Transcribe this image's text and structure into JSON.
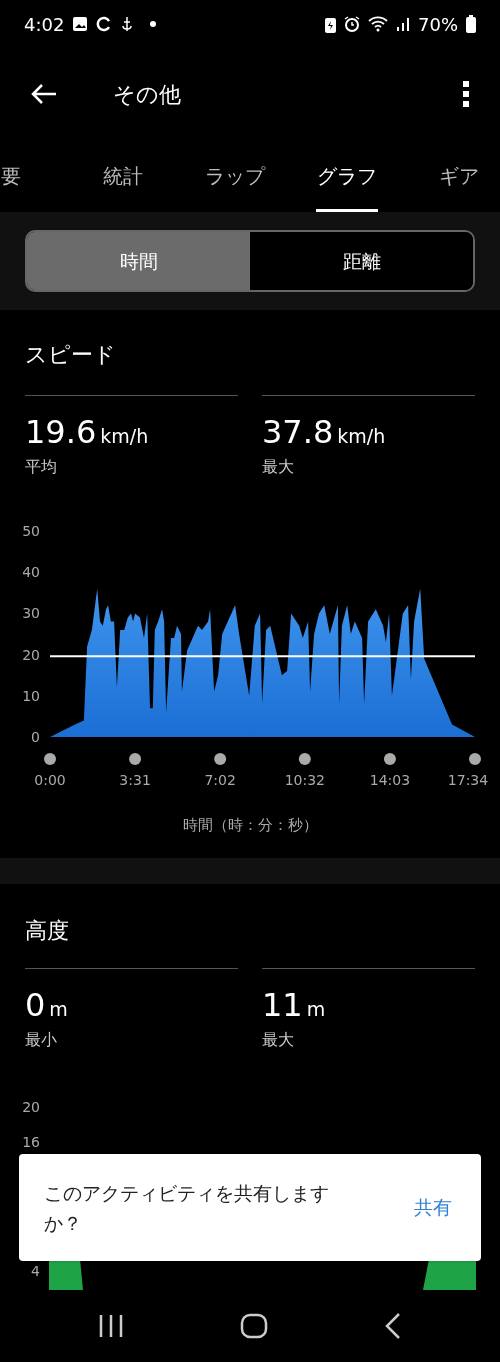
{
  "status_bar": {
    "time": "4:02",
    "battery": "70%"
  },
  "app_bar": {
    "title": "その他"
  },
  "tabs": [
    {
      "label": "要",
      "selected": false
    },
    {
      "label": "統計",
      "selected": false
    },
    {
      "label": "ラップ",
      "selected": false
    },
    {
      "label": "グラフ",
      "selected": true
    },
    {
      "label": "ギア",
      "selected": false
    }
  ],
  "segments": [
    {
      "label": "時間",
      "selected": true
    },
    {
      "label": "距離",
      "selected": false
    }
  ],
  "speed": {
    "title": "スピード",
    "stats": [
      {
        "value": "19.6",
        "unit": "km/h",
        "label": "平均"
      },
      {
        "value": "37.8",
        "unit": "km/h",
        "label": "最大"
      }
    ],
    "chart_data": {
      "type": "area",
      "xlabel": "時間（時：分：秒）",
      "xlim": [
        0,
        1054
      ],
      "ylim": [
        0,
        50
      ],
      "yticks": [
        0,
        10,
        20,
        30,
        40,
        50
      ],
      "xticks": [
        {
          "value": 0,
          "label": "0:00"
        },
        {
          "value": 211,
          "label": "3:31"
        },
        {
          "value": 422,
          "label": "7:02"
        },
        {
          "value": 632,
          "label": "10:32"
        },
        {
          "value": 843,
          "label": "14:03"
        },
        {
          "value": 1054,
          "label": "17:34"
        }
      ],
      "x": [
        0,
        62,
        84,
        92,
        104,
        117,
        124,
        131,
        139,
        144,
        151,
        159,
        166,
        174,
        184,
        193,
        201,
        206,
        211,
        223,
        233,
        241,
        248,
        255,
        260,
        268,
        278,
        283,
        288,
        300,
        308,
        315,
        325,
        327,
        340,
        367,
        377,
        392,
        397,
        407,
        417,
        427,
        441,
        459,
        469,
        494,
        508,
        521,
        526,
        536,
        546,
        575,
        588,
        598,
        618,
        627,
        640,
        645,
        655,
        667,
        680,
        694,
        714,
        717,
        724,
        737,
        746,
        756,
        774,
        779,
        789,
        808,
        826,
        833,
        841,
        848,
        875,
        888,
        895,
        903,
        918,
        928,
        997,
        1054
      ],
      "series": [
        {
          "color": "#2f86e6",
          "values": [
            0,
            3,
            4,
            22,
            26,
            36,
            28,
            27,
            31,
            32,
            28,
            28,
            12,
            26,
            26,
            29,
            30,
            28,
            30,
            29,
            24,
            30,
            7,
            7,
            26,
            28,
            31,
            28,
            6,
            24,
            24,
            27,
            25,
            11,
            21,
            27,
            26,
            28,
            31,
            11,
            15,
            25,
            28,
            32,
            25,
            10,
            27,
            30,
            8,
            26,
            27,
            15,
            16,
            30,
            27,
            24,
            28,
            11,
            25,
            30,
            32,
            25,
            32,
            8,
            27,
            32,
            25,
            28,
            24,
            8,
            28,
            31,
            27,
            23,
            30,
            10,
            30,
            32,
            14,
            28,
            36,
            19,
            3,
            0
          ]
        }
      ],
      "ref_lines": [
        {
          "axis": "y",
          "value": 19.6
        }
      ]
    }
  },
  "altitude": {
    "title": "高度",
    "stats": [
      {
        "value": "0",
        "unit": "m",
        "label": "最小"
      },
      {
        "value": "11",
        "unit": "m",
        "label": "最大"
      }
    ],
    "y_labels": [
      "20",
      "16",
      "4"
    ]
  },
  "snackbar": {
    "message": "このアクティビティを共有しますか？",
    "action": "共有"
  }
}
